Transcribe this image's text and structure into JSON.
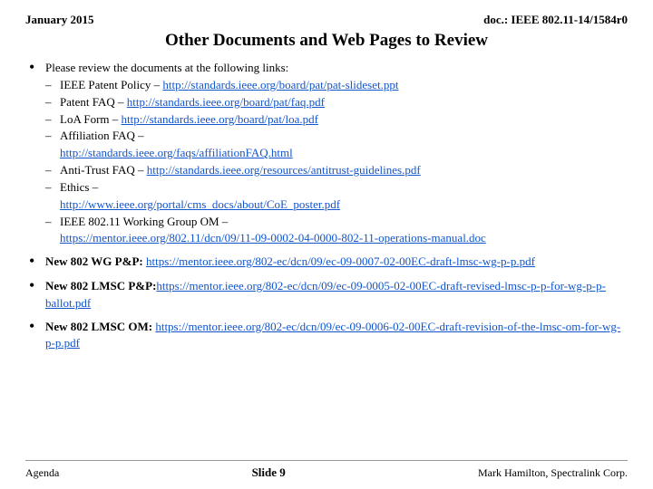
{
  "header": {
    "left": "January 2015",
    "right": "doc.: IEEE 802.11-14/1584r0"
  },
  "title": "Other Documents and Web Pages to Review",
  "bullets": [
    {
      "id": 1,
      "intro": "Please review the documents at the following links:",
      "subitems": [
        {
          "label": "IEEE Patent Policy",
          "separator": " - ",
          "linkText": "http://standards.ieee.org/board/pat/pat-slideset.ppt",
          "linkHref": "http://standards.ieee.org/board/pat/pat-slideset.ppt"
        },
        {
          "label": "Patent FAQ",
          "separator": " - ",
          "linkText": "http://standards.ieee.org/board/pat/faq.pdf",
          "linkHref": "http://standards.ieee.org/board/pat/faq.pdf"
        },
        {
          "label": "LoA Form",
          "separator": " - ",
          "linkText": "http://standards.ieee.org/board/pat/loa.pdf",
          "linkHref": "http://standards.ieee.org/board/pat/loa.pdf"
        },
        {
          "label": "Affiliation FAQ",
          "separator": " - ",
          "linkText": "http://standards.ieee.org/faqs/affiliationFAQ.html",
          "linkHref": "http://standards.ieee.org/faqs/affiliationFAQ.html",
          "labelOnly": true
        },
        {
          "label": "Anti-Trust FAQ",
          "separator": " - ",
          "linkText": "http://standards.ieee.org/resources/antitrust-guidelines.pdf",
          "linkHref": "http://standards.ieee.org/resources/antitrust-guidelines.pdf"
        },
        {
          "label": "Ethics",
          "separator": " - ",
          "linkText": "http://www.ieee.org/portal/cms_docs/about/CoE_poster.pdf",
          "linkHref": "http://www.ieee.org/portal/cms_docs/about/CoE_poster.pdf"
        },
        {
          "label": "IEEE 802.11 Working Group OM",
          "separator": " - ",
          "linkText": "https://mentor.ieee.org/802.11/dcn/09/11-09-0002-04-0000-802-11-operations-manual.doc",
          "linkHref": "https://mentor.ieee.org/802.11/dcn/09/11-09-0002-04-0000-802-11-operations-manual.doc"
        }
      ]
    },
    {
      "id": 2,
      "prefixText": "New 802 WG P&P: ",
      "linkText": "https://mentor.ieee.org/802-ec/dcn/09/ec-09-0007-02-00EC-draft-lmsc-wg-p-p.pdf",
      "linkHref": "https://mentor.ieee.org/802-ec/dcn/09/ec-09-0007-02-00EC-draft-lmsc-wg-p-p.pdf"
    },
    {
      "id": 3,
      "prefixText": "New 802 LMSC P&P: ",
      "linkText": "https://mentor.ieee.org/802-ec/dcn/09/ec-09-0005-02-00EC-draft-revised-lmsc-p-p-for-wg-p-p-ballot.pdf",
      "linkHref": "https://mentor.ieee.org/802-ec/dcn/09/ec-09-0005-02-00EC-draft-revised-lmsc-p-p-for-wg-p-p-ballot.pdf"
    },
    {
      "id": 4,
      "prefixText": "New 802 LMSC OM: ",
      "linkText": "https://mentor.ieee.org/802-ec/dcn/09/ec-09-0006-02-00EC-draft-revision-of-the-lmsc-om-for-wg-p-p.pdf",
      "linkHref": "https://mentor.ieee.org/802-ec/dcn/09/ec-09-0006-02-00EC-draft-revision-of-the-lmsc-om-for-wg-p-p.pdf"
    }
  ],
  "footer": {
    "left": "Agenda",
    "center": "Slide 9",
    "right": "Mark Hamilton, Spectralink Corp."
  }
}
